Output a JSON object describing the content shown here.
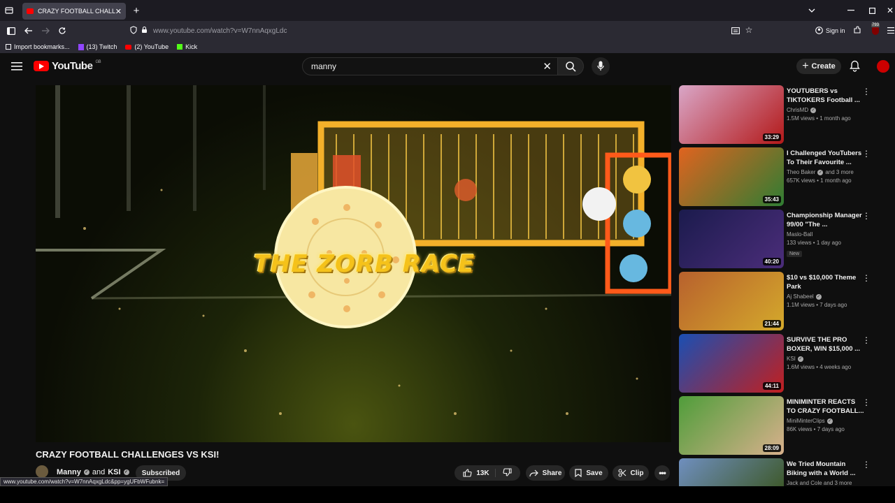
{
  "browser": {
    "tab_title": "CRAZY FOOTBALL CHALLENGES",
    "url": "www.youtube.com/watch?v=W7nnAqxgLdc",
    "sign_in": "Sign in",
    "extension_badge": "793",
    "bookmarks": [
      {
        "label": "Import bookmarks...",
        "icon": "import-icon"
      },
      {
        "label": "(13) Twitch",
        "icon": "twitch-icon"
      },
      {
        "label": "(2) YouTube",
        "icon": "youtube-icon"
      },
      {
        "label": "Kick",
        "icon": "kick-icon"
      }
    ],
    "status_url": "www.youtube.com/watch?v=W7nnAqxgLdc&pp=ygUFbWFubnk="
  },
  "header": {
    "logo_text": "YouTube",
    "region": "GB",
    "search_value": "manny",
    "create_label": "Create"
  },
  "player": {
    "overlay_text": "THE ZORB RACE"
  },
  "video": {
    "title": "CRAZY FOOTBALL CHALLENGES VS KSI!",
    "channel": "Manny",
    "and": "and",
    "channel2": "KSI",
    "subscribe_label": "Subscribed",
    "likes": "13K",
    "share_label": "Share",
    "save_label": "Save",
    "clip_label": "Clip"
  },
  "recommendations": [
    {
      "title": "YOUTUBERS vs TIKTOKERS Football ...",
      "channel": "ChrisMD",
      "verified": true,
      "extra": "",
      "meta": "1.5M views • 1 month ago",
      "duration": "33:29",
      "badge": "",
      "colors": [
        "#d9a6c7",
        "#b31919"
      ]
    },
    {
      "title": "I Challenged YouTubers To Their Favourite ...",
      "channel": "Theo Baker",
      "verified": true,
      "extra": "and 3 more",
      "meta": "657K views • 1 month ago",
      "duration": "35:43",
      "badge": "",
      "colors": [
        "#e0631f",
        "#2f7d33"
      ]
    },
    {
      "title": "Championship Manager 99/00 \"The ...",
      "channel": "Maslo-Ball",
      "verified": false,
      "extra": "",
      "meta": "133 views • 1 day ago",
      "duration": "40:20",
      "badge": "New",
      "colors": [
        "#1b1b4d",
        "#4b2d7a"
      ]
    },
    {
      "title": "$10 vs $10,000 Theme Park",
      "channel": "Aj Shabeel",
      "verified": true,
      "extra": "",
      "meta": "1.1M views • 7 days ago",
      "duration": "21:44",
      "badge": "",
      "colors": [
        "#b8612d",
        "#d4a92b"
      ]
    },
    {
      "title": "SURVIVE THE PRO BOXER, WIN $15,000 ...",
      "channel": "KSI",
      "verified": true,
      "extra": "",
      "meta": "1.6M views • 4 weeks ago",
      "duration": "44:11",
      "badge": "",
      "colors": [
        "#1a4fb3",
        "#c21f1f"
      ]
    },
    {
      "title": "MINIMINTER REACTS TO CRAZY FOOTBALL...",
      "channel": "MiniMinterClips",
      "verified": true,
      "extra": "",
      "meta": "86K views • 7 days ago",
      "duration": "28:09",
      "badge": "",
      "colors": [
        "#4f9d3a",
        "#d8b08c"
      ]
    },
    {
      "title": "We Tried Mountain Biking with a World ...",
      "channel": "Jack and Cole and 3 more",
      "verified": false,
      "extra": "",
      "meta": "",
      "duration": "",
      "badge": "",
      "colors": [
        "#6f8fbf",
        "#3f5a2d"
      ]
    }
  ]
}
